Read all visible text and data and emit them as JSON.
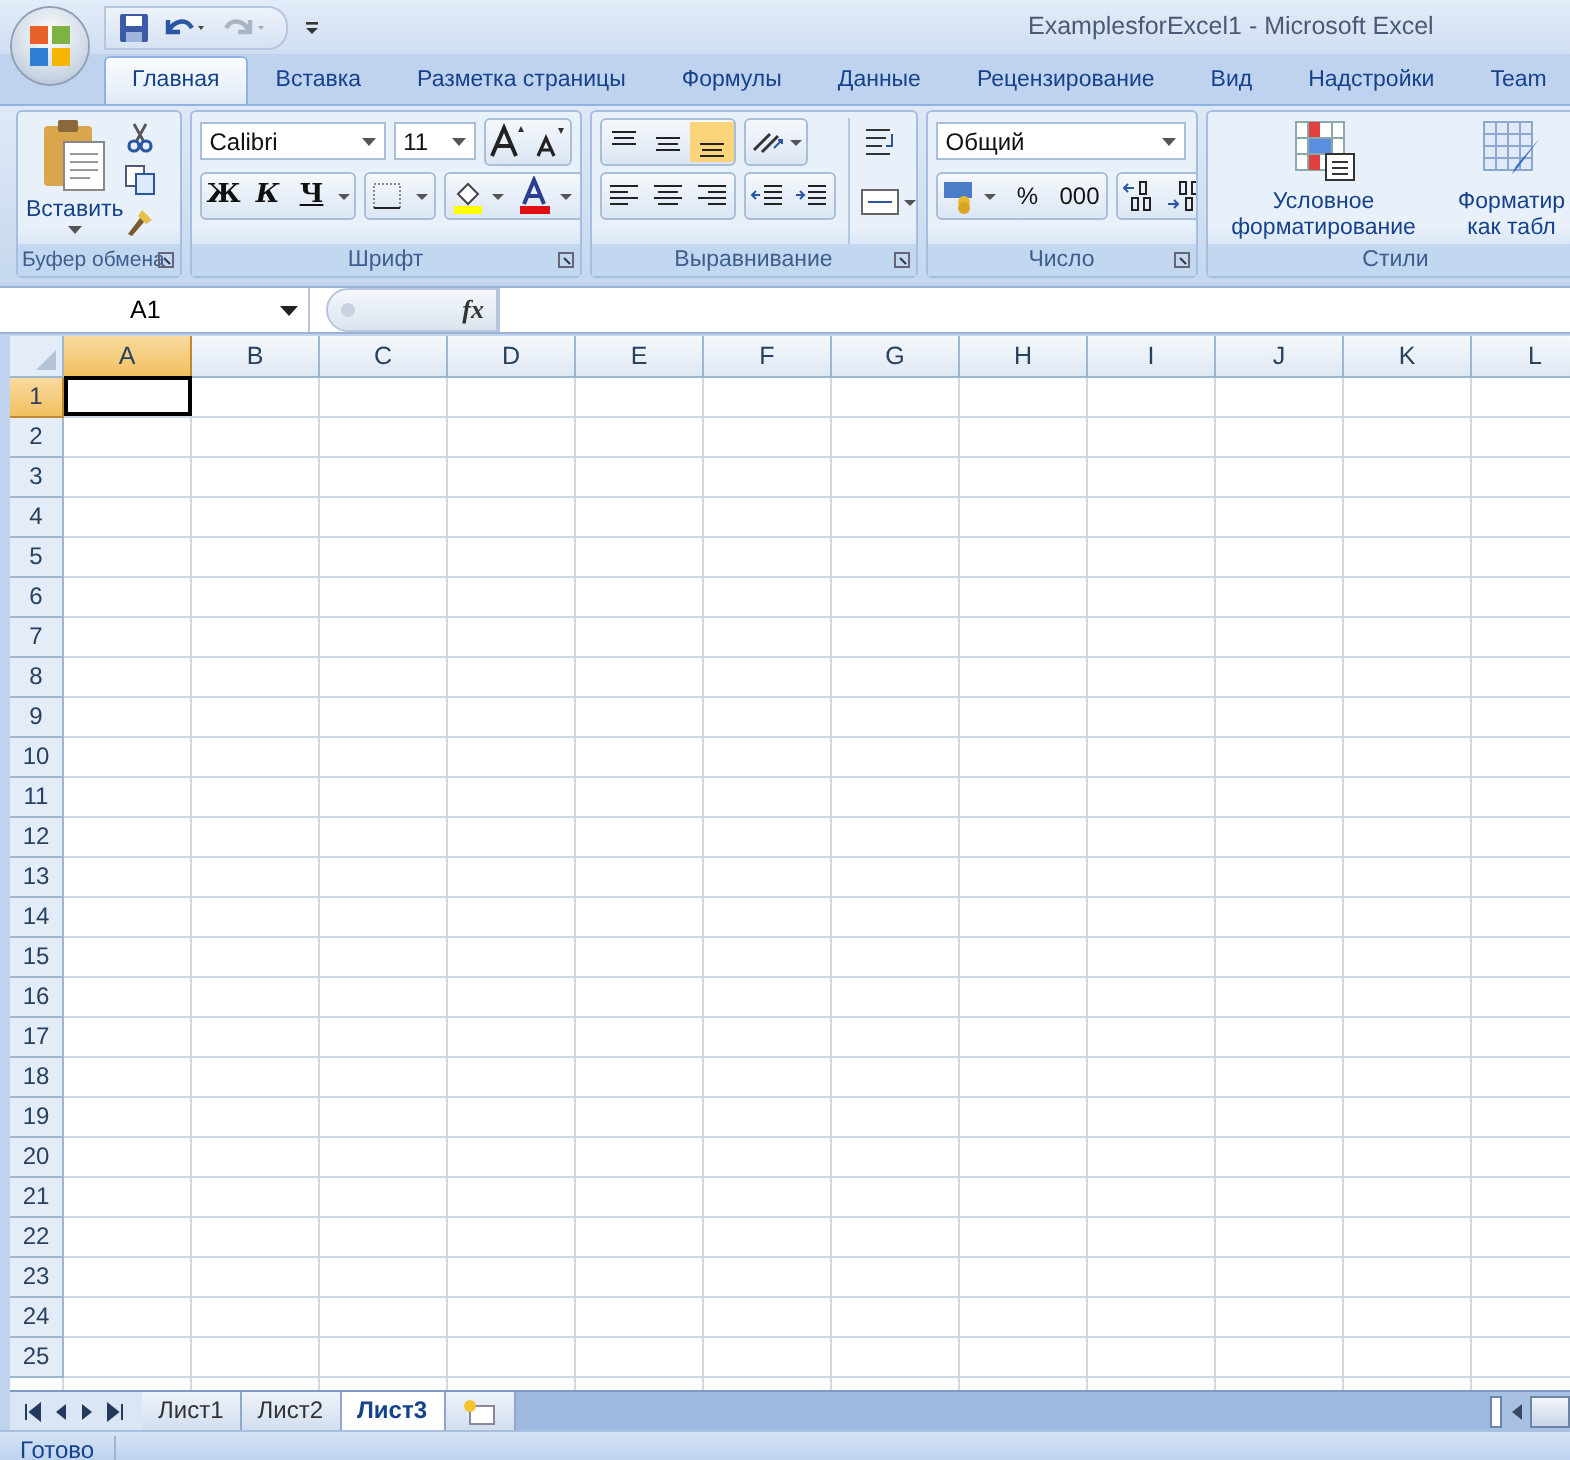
{
  "window": {
    "title": "ExamplesforExcel1  -  Microsoft Excel"
  },
  "tabs": [
    {
      "label": "Главная",
      "selected": true
    },
    {
      "label": "Вставка",
      "selected": false
    },
    {
      "label": "Разметка страницы",
      "selected": false
    },
    {
      "label": "Формулы",
      "selected": false
    },
    {
      "label": "Данные",
      "selected": false
    },
    {
      "label": "Рецензирование",
      "selected": false
    },
    {
      "label": "Вид",
      "selected": false
    },
    {
      "label": "Надстройки",
      "selected": false
    },
    {
      "label": "Team",
      "selected": false
    }
  ],
  "ribbon": {
    "clipboard": {
      "label": "Буфер обмена",
      "paste": "Вставить"
    },
    "font": {
      "label": "Шрифт",
      "font_name": "Calibri",
      "font_size": "11",
      "bold": "Ж",
      "italic": "К",
      "underline": "Ч"
    },
    "alignment": {
      "label": "Выравнивание"
    },
    "number": {
      "label": "Число",
      "format": "Общий",
      "percent": "%",
      "thousands": "000"
    },
    "styles": {
      "label": "Стили",
      "conditional": "Условное форматирование",
      "format_table": "Форматир как табл"
    }
  },
  "formula_bar": {
    "name_box": "A1",
    "fx": "fx"
  },
  "columns": [
    {
      "label": "A",
      "selected": true
    },
    {
      "label": "B",
      "selected": false
    },
    {
      "label": "C",
      "selected": false
    },
    {
      "label": "D",
      "selected": false
    },
    {
      "label": "E",
      "selected": false
    },
    {
      "label": "F",
      "selected": false
    },
    {
      "label": "G",
      "selected": false
    },
    {
      "label": "H",
      "selected": false
    },
    {
      "label": "I",
      "selected": false
    },
    {
      "label": "J",
      "selected": false
    },
    {
      "label": "K",
      "selected": false
    },
    {
      "label": "L",
      "selected": false
    }
  ],
  "rows": [
    {
      "label": "1",
      "selected": true
    },
    {
      "label": "2",
      "selected": false
    },
    {
      "label": "3",
      "selected": false
    },
    {
      "label": "4",
      "selected": false
    },
    {
      "label": "5",
      "selected": false
    },
    {
      "label": "6",
      "selected": false
    },
    {
      "label": "7",
      "selected": false
    },
    {
      "label": "8",
      "selected": false
    },
    {
      "label": "9",
      "selected": false
    },
    {
      "label": "10",
      "selected": false
    },
    {
      "label": "11",
      "selected": false
    },
    {
      "label": "12",
      "selected": false
    },
    {
      "label": "13",
      "selected": false
    },
    {
      "label": "14",
      "selected": false
    },
    {
      "label": "15",
      "selected": false
    },
    {
      "label": "16",
      "selected": false
    },
    {
      "label": "17",
      "selected": false
    },
    {
      "label": "18",
      "selected": false
    },
    {
      "label": "19",
      "selected": false
    },
    {
      "label": "20",
      "selected": false
    },
    {
      "label": "21",
      "selected": false
    },
    {
      "label": "22",
      "selected": false
    },
    {
      "label": "23",
      "selected": false
    },
    {
      "label": "24",
      "selected": false
    },
    {
      "label": "25",
      "selected": false
    }
  ],
  "sheets": [
    {
      "label": "Лист1",
      "selected": false
    },
    {
      "label": "Лист2",
      "selected": false
    },
    {
      "label": "Лист3",
      "selected": true
    }
  ],
  "status_bar": {
    "text": "Готово"
  }
}
